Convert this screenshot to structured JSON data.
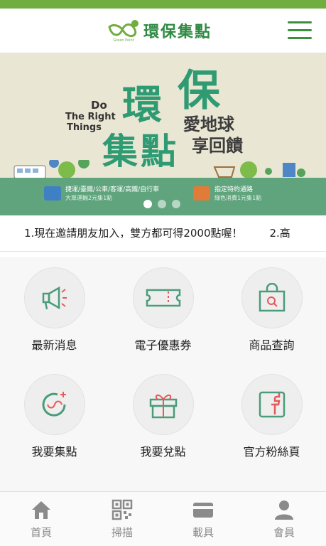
{
  "header": {
    "brand_small": "Green Point",
    "title": "環保集點"
  },
  "banner": {
    "do_right": "Do",
    "the_right": "The Right",
    "things": "Things",
    "big1": "環",
    "big2": "保",
    "big3": "集",
    "big4": "點",
    "slogan1": "愛地球",
    "slogan2": "享回饋",
    "strip_left_line1": "捷運/臺鐵/公車/客運/高鐵/自行車",
    "strip_left_line2": "大眾運輸2元集1點",
    "strip_right_line1": "指定特約通路",
    "strip_right_line2": "綠色消費1元集1點",
    "slides": 3
  },
  "marquee": {
    "item1": "1.現在邀請朋友加入，雙方都可得2000點喔！",
    "item2": "2.高"
  },
  "grid": {
    "items": [
      {
        "label": "最新消息",
        "icon": "megaphone-icon"
      },
      {
        "label": "電子優惠券",
        "icon": "ticket-icon"
      },
      {
        "label": "商品查詢",
        "icon": "shopping-bag-search-icon"
      },
      {
        "label": "我要集點",
        "icon": "collect-points-icon"
      },
      {
        "label": "我要兌點",
        "icon": "gift-icon"
      },
      {
        "label": "官方粉絲頁",
        "icon": "facebook-icon"
      }
    ]
  },
  "tabbar": {
    "items": [
      {
        "label": "首頁",
        "icon": "home-icon"
      },
      {
        "label": "掃描",
        "icon": "qr-code-icon"
      },
      {
        "label": "載具",
        "icon": "card-icon"
      },
      {
        "label": "會員",
        "icon": "user-icon"
      }
    ]
  },
  "colors": {
    "brand_green": "#2f8a43",
    "top_bar": "#6fae3f",
    "banner_strip": "#5fa47d",
    "icon_green": "#4a9c7a"
  }
}
